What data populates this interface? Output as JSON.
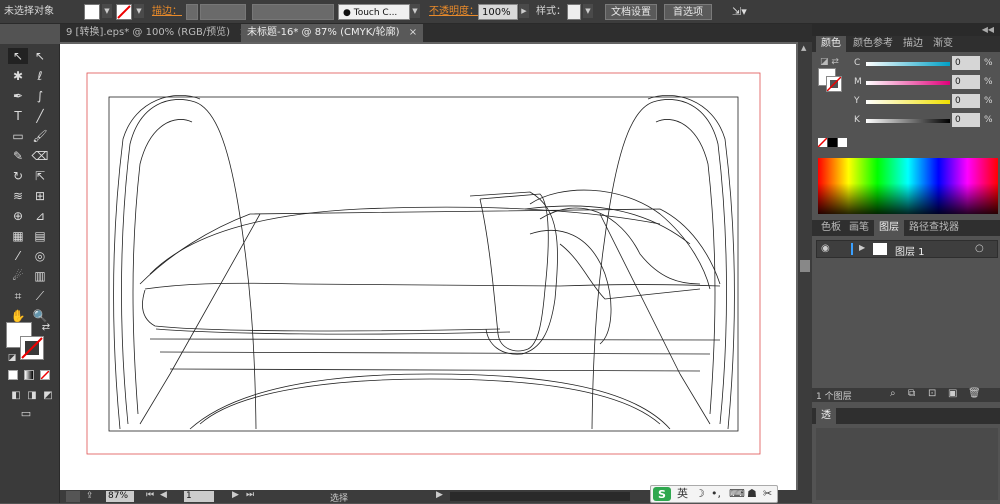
{
  "control_bar": {
    "no_selection": "未选择对象",
    "stroke_label": "描边：",
    "brush_name": "Touch C...",
    "opacity_label": "不透明度：",
    "opacity_value": "100%",
    "style_label": "样式：",
    "doc_settings": "文档设置",
    "preferences": "首选项"
  },
  "tabs": [
    {
      "label": "9 [转换].eps* @ 100% (RGB/预览)",
      "active": false
    },
    {
      "label": "未标题-16* @ 87% (CMYK/轮廓)",
      "active": true
    }
  ],
  "tab_close": "×",
  "status": {
    "zoom": "87%",
    "page": "1",
    "mode": "选择"
  },
  "color_panel": {
    "tabs": [
      "颜色",
      "颜色参考",
      "描边",
      "渐变"
    ],
    "sliders": [
      {
        "label": "C",
        "value": "0",
        "unit": "%",
        "color": "#00a0c6"
      },
      {
        "label": "M",
        "value": "0",
        "unit": "%",
        "color": "#e0007a"
      },
      {
        "label": "Y",
        "value": "0",
        "unit": "%",
        "color": "#f0e000"
      },
      {
        "label": "K",
        "value": "0",
        "unit": "%",
        "color": "#222222"
      }
    ]
  },
  "layers_panel": {
    "tabs": [
      "色板",
      "画笔",
      "图层",
      "路径查找器"
    ],
    "layer_name": "图层 1",
    "layer_count": "1 个图层"
  },
  "bottom_panel": {
    "tab": "透"
  },
  "ime": {
    "label": "英"
  }
}
